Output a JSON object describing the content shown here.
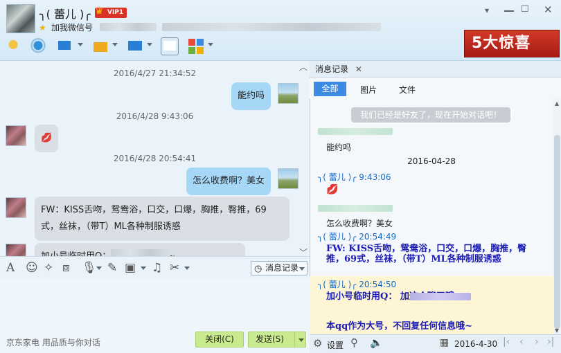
{
  "header": {
    "contact_name": "╮( 蕾儿 )╭",
    "vip_label": "VIP1",
    "signature_label": "加我微信号"
  },
  "window_controls": [
    "minimize-icon",
    "maximize-icon",
    "close-icon"
  ],
  "toolbar_icons": [
    "microphone-icon",
    "video-camera-icon",
    "presentation-icon",
    "file-transfer-icon",
    "remote-desktop-icon",
    "add-chat-icon",
    "apps-grid-icon"
  ],
  "banner": {
    "text": "5大惊喜"
  },
  "chat": {
    "messages": [
      {
        "type": "timestamp",
        "text": "2016/4/27 21:34:52"
      },
      {
        "type": "sent",
        "text": "能约吗"
      },
      {
        "type": "timestamp",
        "text": "2016/4/28 9:43:06"
      },
      {
        "type": "recv",
        "text": "💋"
      },
      {
        "type": "timestamp",
        "text": "2016/4/28 20:54:41"
      },
      {
        "type": "sent",
        "text": "怎么收费啊？美女"
      },
      {
        "type": "recv",
        "text": "FW：KISS舌吻，鸳鸯浴，口交，口爆，胸推，臀推，69式，丝袜，（带T）ML各种制服诱惑"
      },
      {
        "type": "recv",
        "text": "加小号临时用Q：        加这个聊天哦~"
      }
    ]
  },
  "input_toolbar": {
    "history_label": "消息记录",
    "icons": [
      "font-icon",
      "emoji-icon",
      "magic-wand-icon",
      "shake-icon",
      "voice-icon",
      "edit-icon",
      "image-icon",
      "music-icon",
      "scissors-icon"
    ]
  },
  "footer": {
    "ad_text": "京东家电 用品质与你对话",
    "close_label": "关闭(C)",
    "send_label": "发送(S)"
  },
  "history_panel": {
    "tab_label": "消息记录",
    "filters": [
      "全部",
      "图片",
      "文件"
    ],
    "system_notice": "我们已经是好友了，现在开始对话吧！",
    "entries": [
      {
        "kind": "text",
        "text": "能约吗"
      },
      {
        "kind": "date",
        "text": "2016-04-28"
      },
      {
        "kind": "sender",
        "name": "╮( 蕾儿 )╭",
        "time": "9:43:06"
      },
      {
        "kind": "text",
        "text": "💋"
      },
      {
        "kind": "text",
        "text": "怎么收费啊？美女"
      },
      {
        "kind": "sender",
        "name": "╮( 蕾儿 )╭",
        "time": "20:54:49"
      },
      {
        "kind": "bold",
        "text": "FW: KISS舌吻，鸳鸯浴，口交，口爆，胸推，臀推，69式，丝袜，（带T）ML各种制服诱惑"
      },
      {
        "kind": "sender",
        "name": "╮( 蕾儿 )╭",
        "time": "20:54:50"
      },
      {
        "kind": "bold",
        "text": "加小号临时用Q：        加这个聊天哦~"
      },
      {
        "kind": "bold",
        "text": "本qq作为大号，不回复任何信息哦~"
      }
    ],
    "footer": {
      "settings_label": "设置",
      "date_value": "2016-4-30"
    }
  },
  "colors": {
    "accent": "#3b8ae3",
    "sent_bubble": "#a6d7f7",
    "recv_bubble": "#d9dfe4",
    "send_button": "#c9ea8f",
    "vip": "#d83324"
  }
}
